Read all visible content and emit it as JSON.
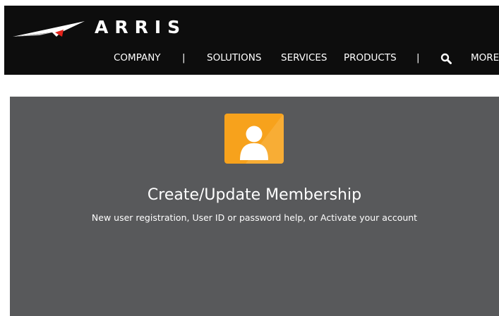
{
  "brand": {
    "logo_text": "ARRIS",
    "logo_icon": "arris-swoosh-logo"
  },
  "nav": {
    "company": "COMPANY",
    "separator": "|",
    "solutions": "SOLUTIONS",
    "services": "SERVICES",
    "products": "PRODUCTS",
    "search_icon": "search-icon",
    "more": "MORE"
  },
  "membership": {
    "icon": "user-icon",
    "title": "Create/Update Membership",
    "subtitle": "New user registration, User ID or password help, or Activate your account"
  },
  "colors": {
    "header_bg": "#0d0d0d",
    "panel_bg": "#58595b",
    "accent_orange": "#f7a21c",
    "logo_red": "#e2231a"
  }
}
